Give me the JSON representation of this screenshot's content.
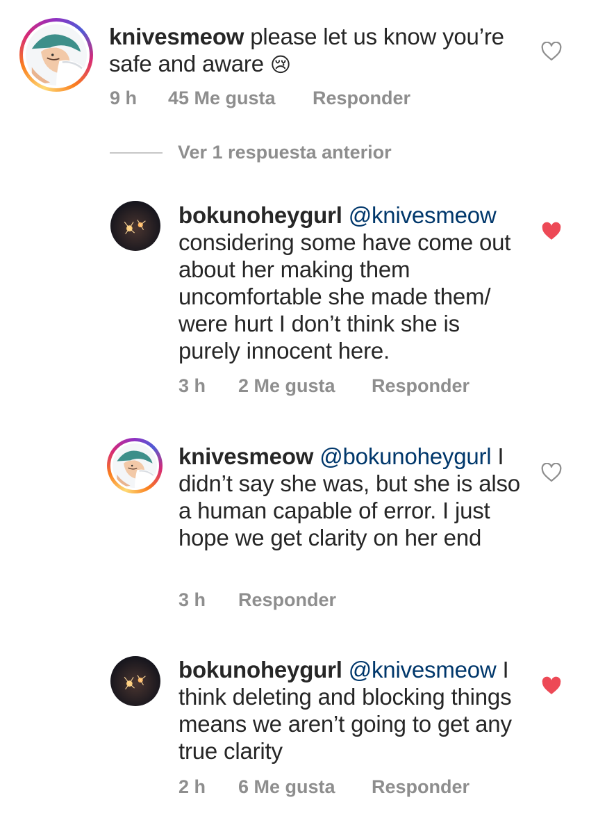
{
  "comments": [
    {
      "username": "knivesmeow",
      "mention": "",
      "text": "please let us know you’re safe and aware",
      "emoji": "😢",
      "time": "9 h",
      "likes": "45 Me gusta",
      "reply": "Responder",
      "liked": false
    },
    {
      "username": "bokunoheygurl",
      "mention": "@knivesmeow",
      "text": "considering some have come out about her making them uncomfortable she made them/ were hurt I don’t think she is purely innocent here.",
      "time": "3 h",
      "likes": "2 Me gusta",
      "reply": "Responder",
      "liked": true
    },
    {
      "username": "knivesmeow",
      "mention": "@bokunoheygurl",
      "text": "I didn’t say she was, but she is also a human capable of error. I just hope we get clarity on her end",
      "time": "3 h",
      "likes": "",
      "reply": "Responder",
      "liked": false
    },
    {
      "username": "bokunoheygurl",
      "mention": "@knivesmeow",
      "text": "I think deleting and blocking things means we aren’t going to get any true clarity",
      "time": "2 h",
      "likes": "6 Me gusta",
      "reply": "Responder",
      "liked": true
    }
  ],
  "view_replies_label": "Ver 1 respuesta anterior",
  "colors": {
    "text": "#262626",
    "meta": "#8e8e8e",
    "mention": "#00376b",
    "heart_liked": "#ed4956",
    "heart_outline": "#8e8e8e"
  },
  "icons": {
    "like_outline": "heart-outline-icon",
    "like_filled": "heart-filled-icon",
    "crying_emoji": "crying-face-emoji"
  }
}
